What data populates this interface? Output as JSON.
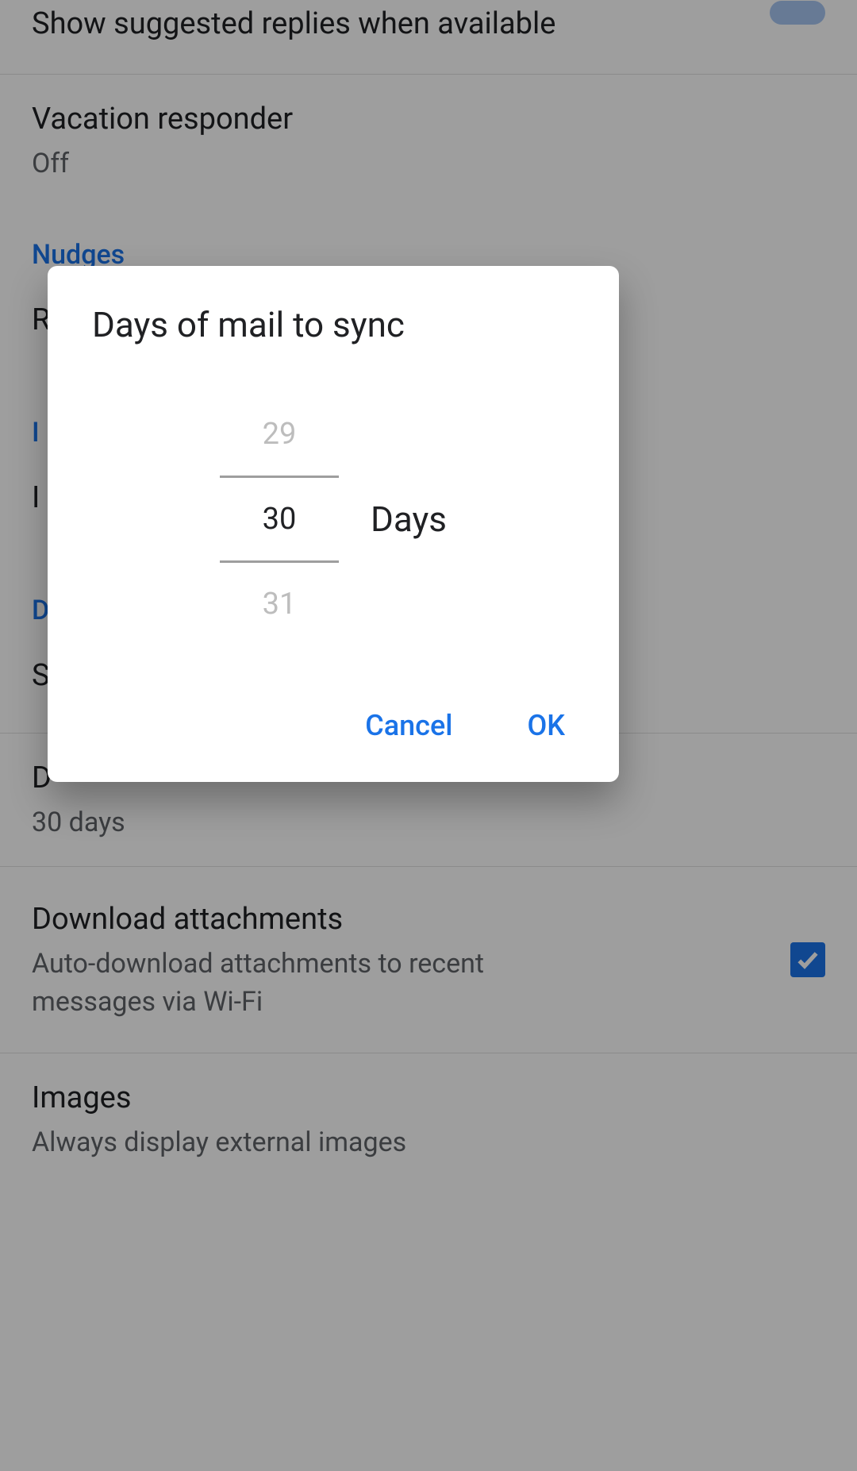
{
  "settings": {
    "smart_reply": {
      "title": "Show suggested replies when available"
    },
    "vacation": {
      "title": "Vacation responder",
      "subtitle": "Off"
    },
    "section_nudges": "Nudges",
    "nudge_reply_letter": "R",
    "section_inbox_letter": "I",
    "inbox_item_letter": "I",
    "section_data_letter": "D",
    "data_item_letter": "S",
    "sync_days": {
      "title_letter": "D",
      "subtitle": "30 days"
    },
    "download": {
      "title": "Download attachments",
      "subtitle": "Auto-download attachments to recent messages via Wi-Fi"
    },
    "images": {
      "title": "Images",
      "subtitle": "Always display external images"
    }
  },
  "dialog": {
    "title": "Days of mail to sync",
    "prev_value": "29",
    "selected_value": "30",
    "next_value": "31",
    "unit_label": "Days",
    "cancel": "Cancel",
    "ok": "OK"
  }
}
